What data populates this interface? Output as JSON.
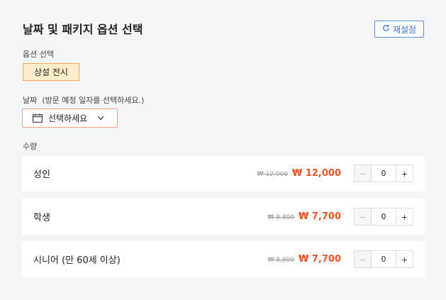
{
  "header": {
    "title": "날짜 및 패키지 옵션 선택",
    "reset_label": "재설정"
  },
  "option": {
    "section_label": "옵션 선택",
    "selected_label": "상설 전시"
  },
  "date": {
    "section_label": "날짜  (방문 예정 일자를 선택하세요.)",
    "picker_label": "선택하세요"
  },
  "quantity": {
    "section_label": "수량",
    "rows": [
      {
        "name": "성인",
        "original_price": "₩ 12,000",
        "sale_price": "₩ 12,000",
        "qty": "0",
        "minus": "−",
        "plus": "+"
      },
      {
        "name": "학생",
        "original_price": "₩ 8,800",
        "sale_price": "₩ 7,700",
        "qty": "0",
        "minus": "−",
        "plus": "+"
      },
      {
        "name": "시니어 (만 60세 이상)",
        "original_price": "₩ 8,800",
        "sale_price": "₩ 7,700",
        "qty": "0",
        "minus": "−",
        "plus": "+"
      }
    ]
  },
  "colors": {
    "accent_blue": "#3a72d8",
    "chip_bg": "#ffedcc",
    "chip_border": "#f0a94a",
    "sale_red": "#e9552b"
  }
}
